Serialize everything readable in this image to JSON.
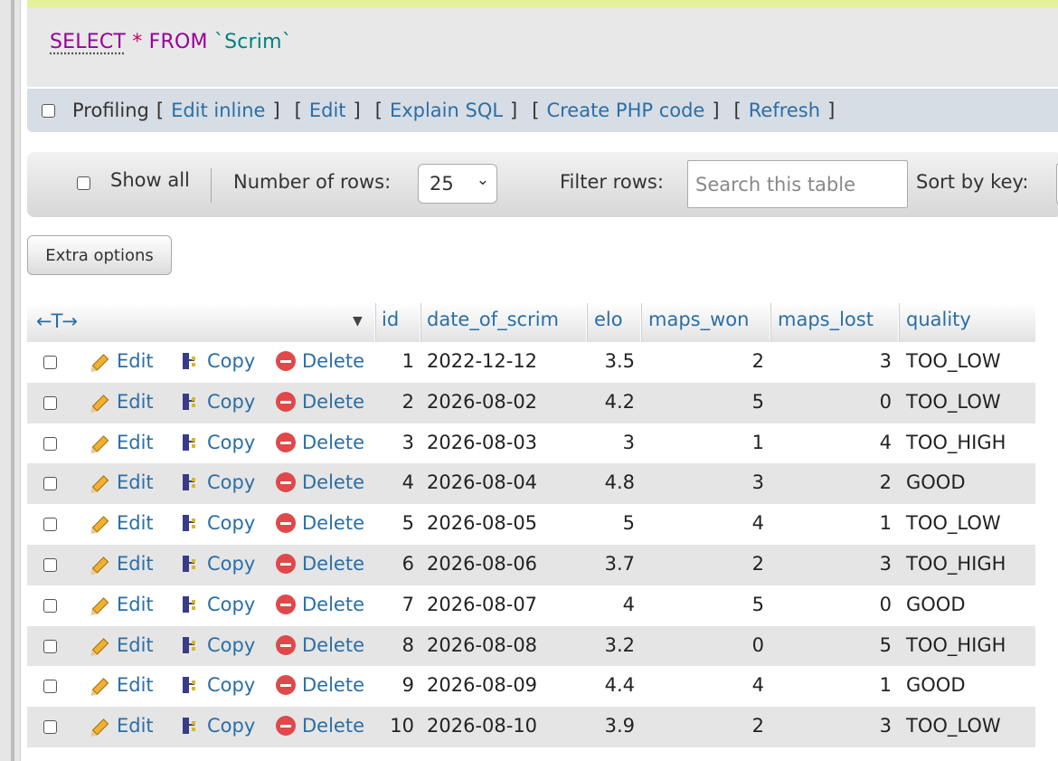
{
  "sql": {
    "select": "SELECT",
    "star": "*",
    "from": "FROM",
    "table": "`Scrim`"
  },
  "profiling": {
    "label": "Profiling",
    "links": [
      "Edit inline",
      "Edit",
      "Explain SQL",
      "Create PHP code",
      "Refresh"
    ]
  },
  "nav": {
    "show_all": "Show all",
    "rows_label": "Number of rows:",
    "rows_value": "25",
    "filter_label": "Filter rows:",
    "search_placeholder": "Search this table",
    "sort_label": "Sort by key:"
  },
  "extra_options": "Extra options",
  "table": {
    "arrows": "←T→",
    "columns": [
      "id",
      "date_of_scrim",
      "elo",
      "maps_won",
      "maps_lost",
      "quality"
    ],
    "actions": {
      "edit": "Edit",
      "copy": "Copy",
      "delete": "Delete"
    },
    "rows": [
      {
        "id": "1",
        "date": "2022-12-12",
        "elo": "3.5",
        "won": "2",
        "lost": "3",
        "quality": "TOO_LOW"
      },
      {
        "id": "2",
        "date": "2026-08-02",
        "elo": "4.2",
        "won": "5",
        "lost": "0",
        "quality": "TOO_LOW"
      },
      {
        "id": "3",
        "date": "2026-08-03",
        "elo": "3",
        "won": "1",
        "lost": "4",
        "quality": "TOO_HIGH"
      },
      {
        "id": "4",
        "date": "2026-08-04",
        "elo": "4.8",
        "won": "3",
        "lost": "2",
        "quality": "GOOD"
      },
      {
        "id": "5",
        "date": "2026-08-05",
        "elo": "5",
        "won": "4",
        "lost": "1",
        "quality": "TOO_LOW"
      },
      {
        "id": "6",
        "date": "2026-08-06",
        "elo": "3.7",
        "won": "2",
        "lost": "3",
        "quality": "TOO_HIGH"
      },
      {
        "id": "7",
        "date": "2026-08-07",
        "elo": "4",
        "won": "5",
        "lost": "0",
        "quality": "GOOD"
      },
      {
        "id": "8",
        "date": "2026-08-08",
        "elo": "3.2",
        "won": "0",
        "lost": "5",
        "quality": "TOO_HIGH"
      },
      {
        "id": "9",
        "date": "2026-08-09",
        "elo": "4.4",
        "won": "4",
        "lost": "1",
        "quality": "GOOD"
      },
      {
        "id": "10",
        "date": "2026-08-10",
        "elo": "3.9",
        "won": "2",
        "lost": "3",
        "quality": "TOO_LOW"
      }
    ]
  }
}
